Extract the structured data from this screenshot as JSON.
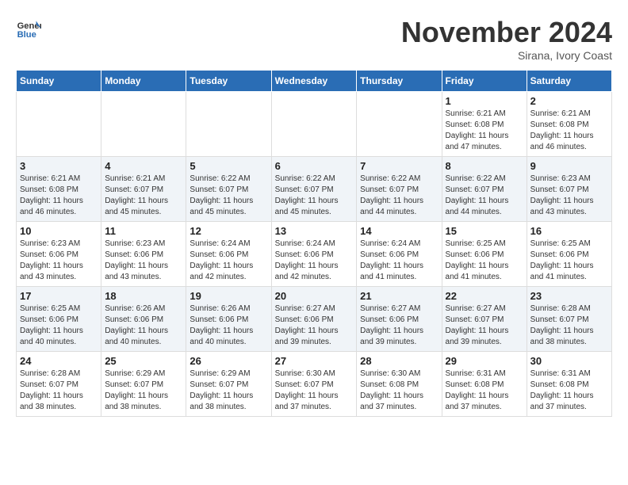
{
  "header": {
    "logo_line1": "General",
    "logo_line2": "Blue",
    "month": "November 2024",
    "location": "Sirana, Ivory Coast"
  },
  "days_of_week": [
    "Sunday",
    "Monday",
    "Tuesday",
    "Wednesday",
    "Thursday",
    "Friday",
    "Saturday"
  ],
  "weeks": [
    [
      {
        "day": "",
        "info": ""
      },
      {
        "day": "",
        "info": ""
      },
      {
        "day": "",
        "info": ""
      },
      {
        "day": "",
        "info": ""
      },
      {
        "day": "",
        "info": ""
      },
      {
        "day": "1",
        "info": "Sunrise: 6:21 AM\nSunset: 6:08 PM\nDaylight: 11 hours\nand 47 minutes."
      },
      {
        "day": "2",
        "info": "Sunrise: 6:21 AM\nSunset: 6:08 PM\nDaylight: 11 hours\nand 46 minutes."
      }
    ],
    [
      {
        "day": "3",
        "info": "Sunrise: 6:21 AM\nSunset: 6:08 PM\nDaylight: 11 hours\nand 46 minutes."
      },
      {
        "day": "4",
        "info": "Sunrise: 6:21 AM\nSunset: 6:07 PM\nDaylight: 11 hours\nand 45 minutes."
      },
      {
        "day": "5",
        "info": "Sunrise: 6:22 AM\nSunset: 6:07 PM\nDaylight: 11 hours\nand 45 minutes."
      },
      {
        "day": "6",
        "info": "Sunrise: 6:22 AM\nSunset: 6:07 PM\nDaylight: 11 hours\nand 45 minutes."
      },
      {
        "day": "7",
        "info": "Sunrise: 6:22 AM\nSunset: 6:07 PM\nDaylight: 11 hours\nand 44 minutes."
      },
      {
        "day": "8",
        "info": "Sunrise: 6:22 AM\nSunset: 6:07 PM\nDaylight: 11 hours\nand 44 minutes."
      },
      {
        "day": "9",
        "info": "Sunrise: 6:23 AM\nSunset: 6:07 PM\nDaylight: 11 hours\nand 43 minutes."
      }
    ],
    [
      {
        "day": "10",
        "info": "Sunrise: 6:23 AM\nSunset: 6:06 PM\nDaylight: 11 hours\nand 43 minutes."
      },
      {
        "day": "11",
        "info": "Sunrise: 6:23 AM\nSunset: 6:06 PM\nDaylight: 11 hours\nand 43 minutes."
      },
      {
        "day": "12",
        "info": "Sunrise: 6:24 AM\nSunset: 6:06 PM\nDaylight: 11 hours\nand 42 minutes."
      },
      {
        "day": "13",
        "info": "Sunrise: 6:24 AM\nSunset: 6:06 PM\nDaylight: 11 hours\nand 42 minutes."
      },
      {
        "day": "14",
        "info": "Sunrise: 6:24 AM\nSunset: 6:06 PM\nDaylight: 11 hours\nand 41 minutes."
      },
      {
        "day": "15",
        "info": "Sunrise: 6:25 AM\nSunset: 6:06 PM\nDaylight: 11 hours\nand 41 minutes."
      },
      {
        "day": "16",
        "info": "Sunrise: 6:25 AM\nSunset: 6:06 PM\nDaylight: 11 hours\nand 41 minutes."
      }
    ],
    [
      {
        "day": "17",
        "info": "Sunrise: 6:25 AM\nSunset: 6:06 PM\nDaylight: 11 hours\nand 40 minutes."
      },
      {
        "day": "18",
        "info": "Sunrise: 6:26 AM\nSunset: 6:06 PM\nDaylight: 11 hours\nand 40 minutes."
      },
      {
        "day": "19",
        "info": "Sunrise: 6:26 AM\nSunset: 6:06 PM\nDaylight: 11 hours\nand 40 minutes."
      },
      {
        "day": "20",
        "info": "Sunrise: 6:27 AM\nSunset: 6:06 PM\nDaylight: 11 hours\nand 39 minutes."
      },
      {
        "day": "21",
        "info": "Sunrise: 6:27 AM\nSunset: 6:06 PM\nDaylight: 11 hours\nand 39 minutes."
      },
      {
        "day": "22",
        "info": "Sunrise: 6:27 AM\nSunset: 6:07 PM\nDaylight: 11 hours\nand 39 minutes."
      },
      {
        "day": "23",
        "info": "Sunrise: 6:28 AM\nSunset: 6:07 PM\nDaylight: 11 hours\nand 38 minutes."
      }
    ],
    [
      {
        "day": "24",
        "info": "Sunrise: 6:28 AM\nSunset: 6:07 PM\nDaylight: 11 hours\nand 38 minutes."
      },
      {
        "day": "25",
        "info": "Sunrise: 6:29 AM\nSunset: 6:07 PM\nDaylight: 11 hours\nand 38 minutes."
      },
      {
        "day": "26",
        "info": "Sunrise: 6:29 AM\nSunset: 6:07 PM\nDaylight: 11 hours\nand 38 minutes."
      },
      {
        "day": "27",
        "info": "Sunrise: 6:30 AM\nSunset: 6:07 PM\nDaylight: 11 hours\nand 37 minutes."
      },
      {
        "day": "28",
        "info": "Sunrise: 6:30 AM\nSunset: 6:08 PM\nDaylight: 11 hours\nand 37 minutes."
      },
      {
        "day": "29",
        "info": "Sunrise: 6:31 AM\nSunset: 6:08 PM\nDaylight: 11 hours\nand 37 minutes."
      },
      {
        "day": "30",
        "info": "Sunrise: 6:31 AM\nSunset: 6:08 PM\nDaylight: 11 hours\nand 37 minutes."
      }
    ]
  ]
}
